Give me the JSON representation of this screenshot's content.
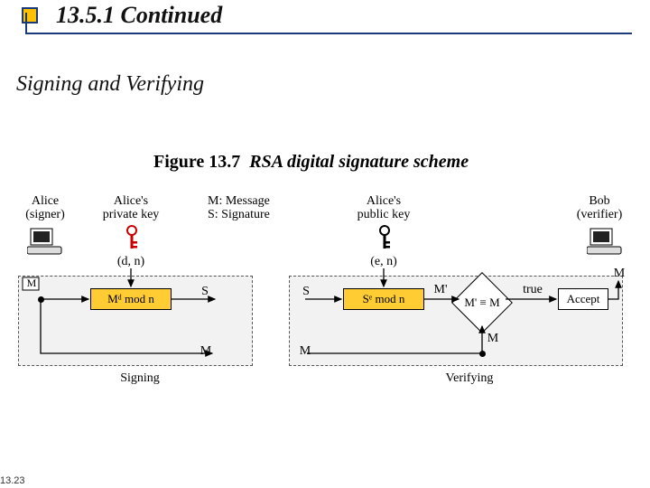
{
  "header": {
    "title": "13.5.1  Continued"
  },
  "subtitle": "Signing and Verifying",
  "figure": {
    "number": "Figure 13.7",
    "caption": "RSA digital signature scheme"
  },
  "diagram": {
    "alice_label": "Alice\n(signer)",
    "bob_label": "Bob\n(verifier)",
    "alice_priv": "Alice's\nprivate key",
    "alice_pub": "Alice's\npublic key",
    "msg_sig": "M: Message\nS: Signature",
    "dn": "(d, n)",
    "en": "(e, n)",
    "sign_op": "Mᵈ mod n",
    "verify_op": "Sᵉ mod n",
    "compare": "M' ≡ M",
    "accept": "Accept",
    "M": "M",
    "S": "S",
    "Mprime": "M'",
    "true": "true",
    "signing": "Signing",
    "verifying": "Verifying"
  },
  "footer": "13.23"
}
